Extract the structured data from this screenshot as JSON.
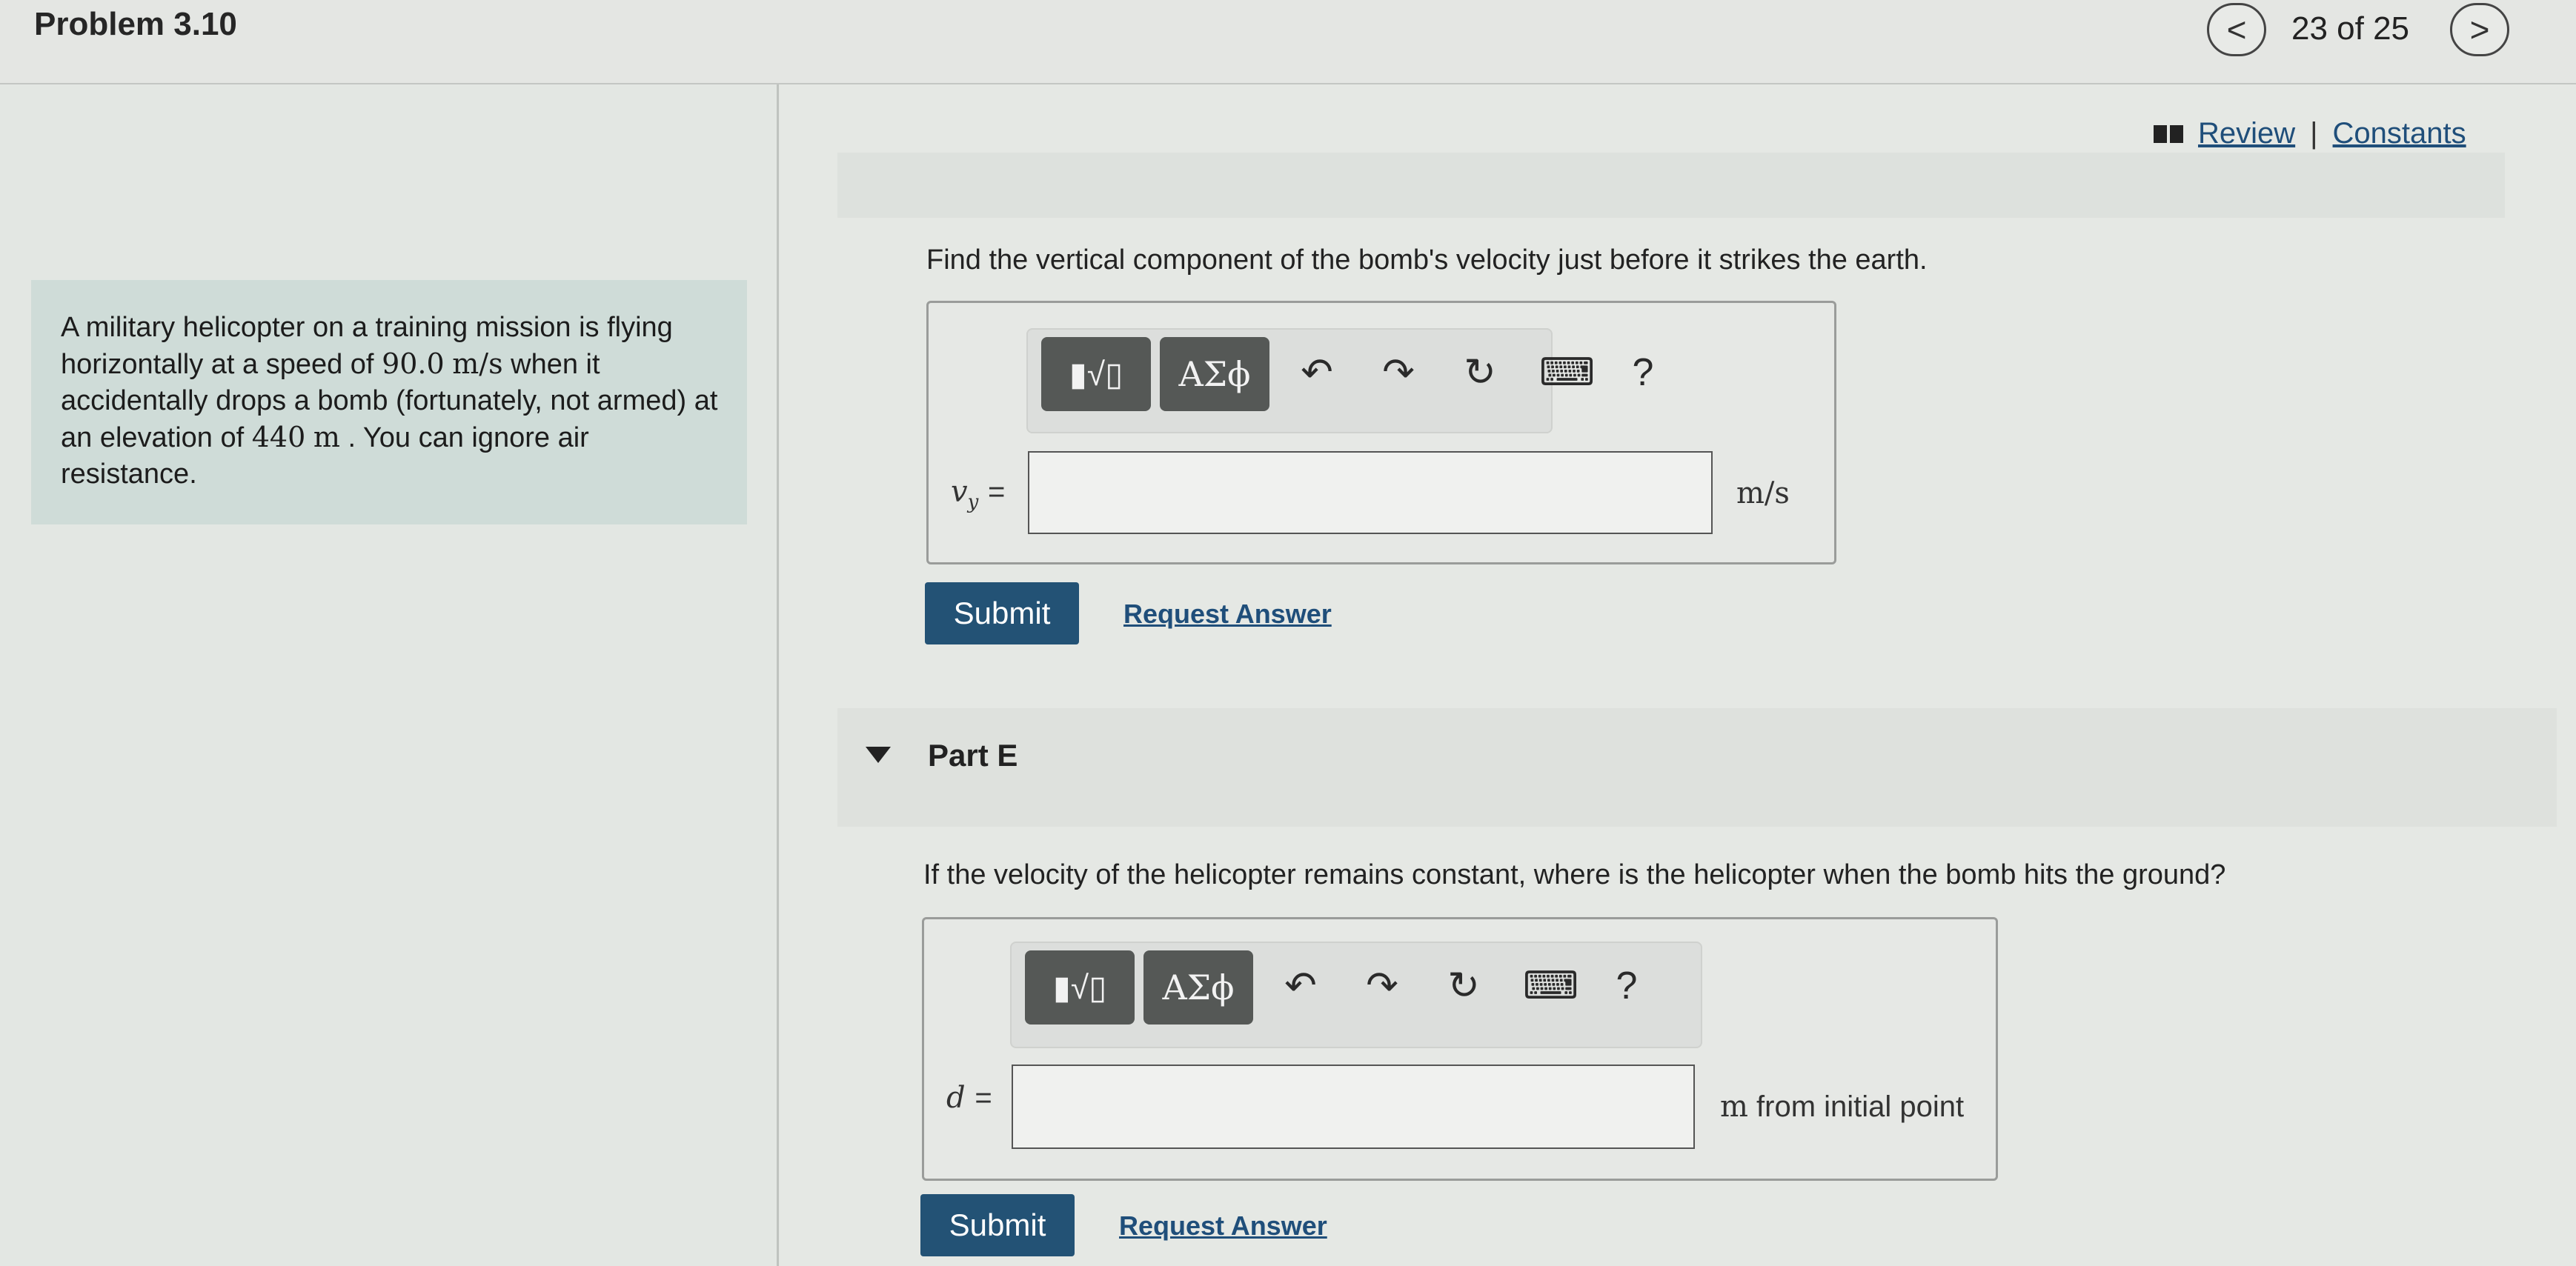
{
  "header": {
    "title": "Problem 3.10",
    "prev_icon": "<",
    "next_icon": ">",
    "page_count": "23 of 25"
  },
  "links": {
    "review": "Review",
    "separator": "|",
    "constants": "Constants"
  },
  "context": {
    "part1": "A military helicopter on a training mission is flying horizontally at a speed of ",
    "speed": "90.0",
    "speed_unit": "m/s",
    "part2": " when it accidentally drops a bomb (fortunately, not armed) at an elevation of ",
    "elevation": "440",
    "elevation_unit": "m",
    "part3": ". You can ignore air resistance."
  },
  "part_d": {
    "question": "Find the vertical component of the bomb's velocity just before it strikes the earth.",
    "toolbar": {
      "template_label": "▮√▯",
      "greek_label": "ΑΣϕ",
      "undo": "↶",
      "redo": "↷",
      "reset": "↻",
      "keyboard": "⌨",
      "help": "?"
    },
    "variable": "v",
    "variable_sub": "y",
    "equals": "=",
    "input_value": "",
    "unit": "m/s",
    "submit": "Submit",
    "request_answer": "Request Answer"
  },
  "part_e": {
    "title": "Part E",
    "question": "If the velocity of the helicopter remains constant, where is the helicopter when the bomb hits the ground?",
    "toolbar": {
      "template_label": "▮√▯",
      "greek_label": "ΑΣϕ",
      "undo": "↶",
      "redo": "↷",
      "reset": "↻",
      "keyboard": "⌨",
      "help": "?"
    },
    "variable": "d",
    "equals": "=",
    "input_value": "",
    "unit_m": "m",
    "unit_rest": " from initial point",
    "submit": "Submit",
    "request_answer": "Request Answer"
  }
}
